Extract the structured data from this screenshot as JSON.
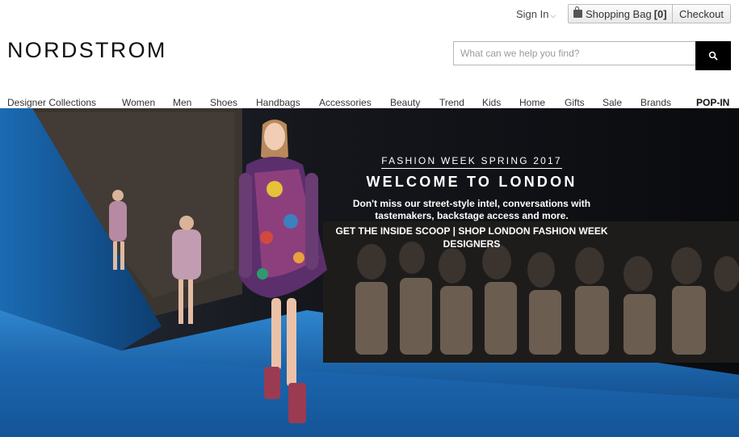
{
  "header": {
    "sign_in": "Sign In",
    "shopping_bag_label": "Shopping Bag",
    "shopping_bag_count": "[0]",
    "checkout": "Checkout",
    "logo": "NORDSTROM"
  },
  "search": {
    "placeholder": "What can we help you find?",
    "value": ""
  },
  "nav": {
    "items": [
      "Designer Collections",
      "Women",
      "Men",
      "Shoes",
      "Handbags",
      "Accessories",
      "Beauty",
      "Trend",
      "Kids",
      "Home",
      "Gifts",
      "Sale",
      "Brands",
      "POP-IN"
    ]
  },
  "hero": {
    "eyebrow": "FASHION WEEK SPRING 2017",
    "headline": "WELCOME TO LONDON",
    "body": "Don't miss our street-style intel, conversations with tastemakers, backstage access and more.",
    "link_inside_scoop": "GET THE INSIDE SCOOP",
    "separator": "|",
    "link_shop": "SHOP LONDON FASHION WEEK DESIGNERS"
  },
  "colors": {
    "accent": "#000000",
    "runway_blue": "#1f6fb8",
    "text": "#222222"
  },
  "icons": {
    "search": "search-icon",
    "bag": "shopping-bag-icon",
    "caret": "chevron-down-icon"
  }
}
